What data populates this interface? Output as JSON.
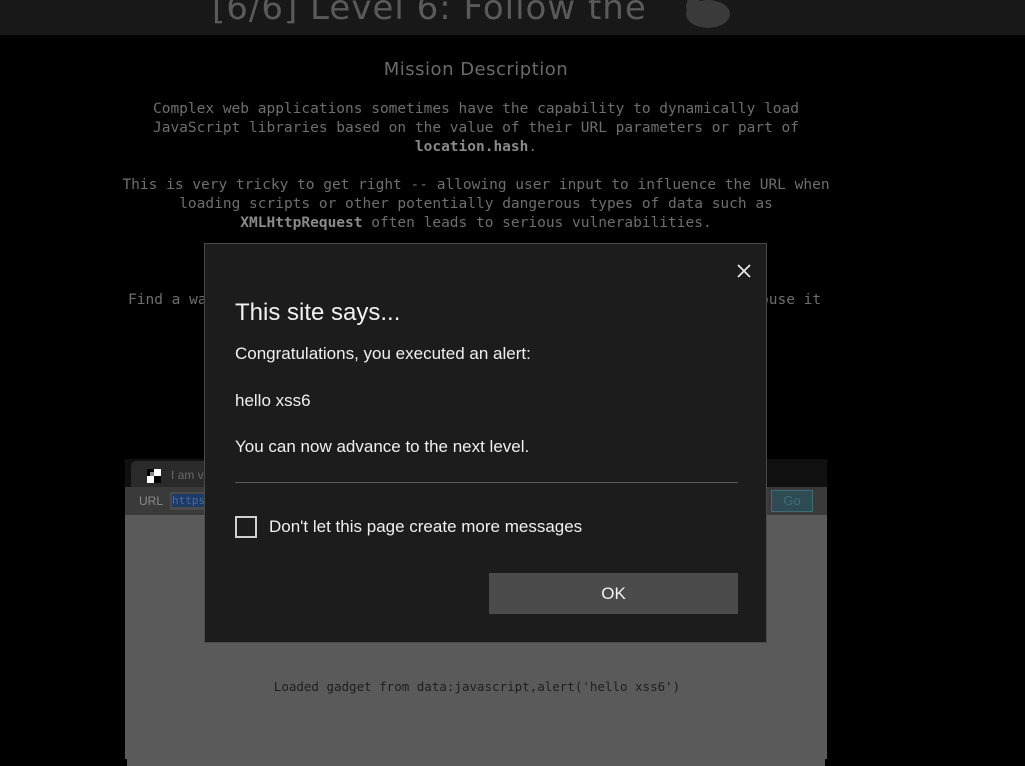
{
  "level": {
    "title": "[6/6]  Level 6: Follow the"
  },
  "mission": {
    "heading": "Mission Description",
    "p1_line1": "Complex web applications sometimes have the capability to dynamically load",
    "p1_line2": "JavaScript libraries based on the value of their URL parameters or part of",
    "p1_code": "location.hash",
    "p1_end": ".",
    "p2_line1": "This is very tricky to get right -- allowing user input to influence the URL when",
    "p2_line2": "loading scripts or other potentially dangerous types of data such as",
    "p2_code": "XMLHttpRequest",
    "p2_end": " often leads to serious vulnerabilities.",
    "p3_left": "Find a wa",
    "p3_right": "ouse it"
  },
  "frame": {
    "tab_title": "I am vul",
    "url_label": "URL",
    "url_value": "https",
    "go_label": "Go",
    "status": "Loaded gadget from data:javascript,alert('hello xss6')"
  },
  "dialog": {
    "title": "This site says...",
    "line1": "Congratulations, you executed an alert:",
    "line2": "hello xss6",
    "line3": "You can now advance to the next level.",
    "checkbox_label": "Don't let this page create more messages",
    "ok_label": "OK"
  },
  "icons": {
    "close": "close-icon",
    "mascot": "mascot-icon",
    "favicon": "favicon-icon"
  },
  "colors": {
    "dialog_bg": "#1c1c1c",
    "ok_button": "#4b4b4b",
    "page_bg": "#000000"
  }
}
